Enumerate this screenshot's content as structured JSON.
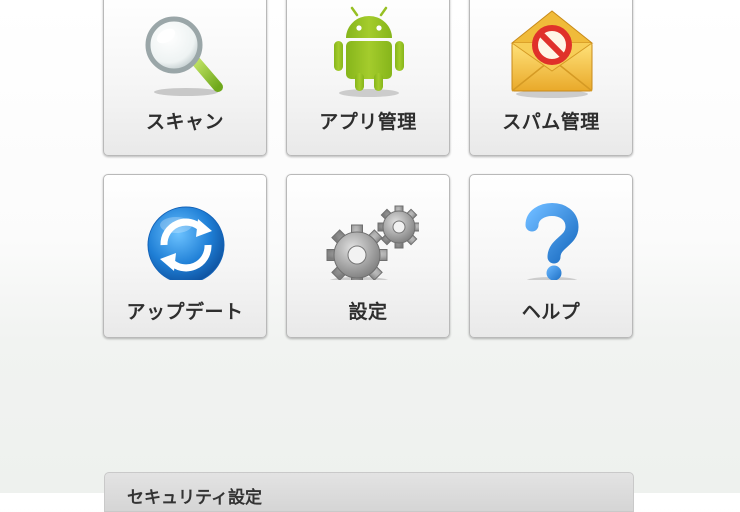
{
  "menu": {
    "scan": {
      "label": "スキャン",
      "icon": "magnifier-icon"
    },
    "app_management": {
      "label": "アプリ管理",
      "icon": "android-icon"
    },
    "spam_management": {
      "label": "スパム管理",
      "icon": "blocked-mail-icon"
    },
    "update": {
      "label": "アップデート",
      "icon": "sync-icon"
    },
    "settings": {
      "label": "設定",
      "icon": "gears-icon"
    },
    "help": {
      "label": "ヘルプ",
      "icon": "question-mark-icon"
    }
  },
  "section": {
    "title": "セキュリティ設定"
  },
  "colors": {
    "android_green": "#97c024",
    "sync_blue": "#1f7fd6",
    "help_blue": "#2a86df",
    "envelope_yellow": "#f6c94a",
    "block_red": "#e0312a"
  }
}
